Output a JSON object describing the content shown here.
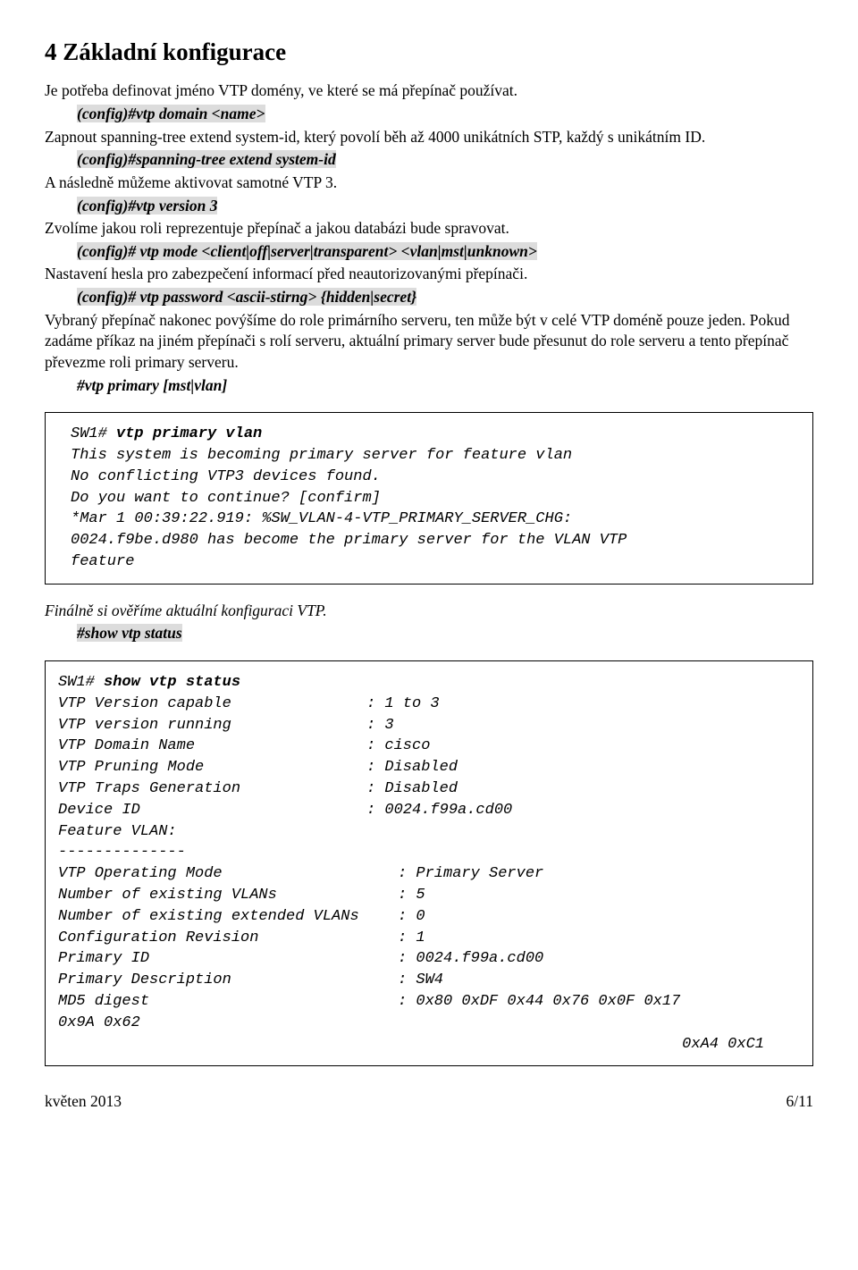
{
  "heading": "4  Základní konfigurace",
  "p_intro": "Je potřeba definovat jméno VTP domény, ve které se má přepínač používat.",
  "cmd1": "(config)#vtp domain <name>",
  "p_after_cmd1": "Zapnout spanning-tree extend system-id, který povolí běh až 4000 unikátních STP, každý s unikátním ID.",
  "cmd2": "(config)#spanning-tree extend system-id",
  "p_after_cmd2": "A následně můžeme aktivovat samotné VTP 3.",
  "cmd3": "(config)#vtp version 3",
  "p_after_cmd3": "Zvolíme jakou roli reprezentuje přepínač a jakou databázi bude spravovat.",
  "cmd4": "(config)# vtp mode <client|off|server|transparent> <vlan|mst|unknown>",
  "p_after_cmd4": "Nastavení hesla pro zabezpečení informací před neautorizovanými přepínači.",
  "cmd5": "(config)# vtp password <ascii-stirng> {hidden|secret}",
  "p_after_cmd5": "Vybraný přepínač nakonec povýšíme do role primárního serveru, ten může být v celé VTP doméně pouze jeden. Pokud zadáme příkaz na jiném přepínači s rolí serveru, aktuální primary server bude přesunut do role serveru a tento přepínač převezme roli primary serveru.",
  "cmd6": "#vtp primary [mst|vlan]",
  "codebox1": {
    "prompt": "SW1# ",
    "cmd": "vtp primary vlan",
    "lines": [
      "This system is becoming primary server for feature vlan",
      "No conflicting VTP3 devices found.",
      "Do you want to continue? [confirm]",
      "*Mar 1 00:39:22.919: %SW_VLAN-4-VTP_PRIMARY_SERVER_CHG:",
      "0024.f9be.d980 has become the primary server for the VLAN VTP",
      "feature"
    ]
  },
  "p_final": "Finálně si ověříme aktuální konfiguraci VTP.",
  "cmd7": "#show vtp status",
  "codebox2": {
    "prompt": "SW1# ",
    "cmd": "show vtp status",
    "rows": [
      {
        "k": "VTP Version capable",
        "v": ": 1 to 3"
      },
      {
        "k": "VTP version running",
        "v": ": 3"
      },
      {
        "k": "VTP Domain Name",
        "v": ": cisco"
      },
      {
        "k": "VTP Pruning Mode",
        "v": ": Disabled"
      },
      {
        "k": "VTP Traps Generation",
        "v": ": Disabled"
      },
      {
        "k": "Device ID",
        "v": ": 0024.f99a.cd00"
      }
    ],
    "plain1": "Feature VLAN:",
    "plain2": "--------------",
    "rows2": [
      {
        "k": "VTP Operating Mode",
        "v": ": Primary Server"
      },
      {
        "k": "Number of existing VLANs",
        "v": ": 5"
      },
      {
        "k": "Number of existing extended VLANs",
        "v": ": 0"
      },
      {
        "k": "Configuration Revision",
        "v": ": 1"
      },
      {
        "k": "Primary ID",
        "v": ": 0024.f99a.cd00"
      },
      {
        "k": "Primary Description",
        "v": ": SW4"
      },
      {
        "k": "MD5 digest",
        "v": ": 0x80 0xDF 0x44 0x76 0x0F 0x17"
      }
    ],
    "tail1": "0x9A 0x62",
    "tail2": "0xA4 0xC1"
  },
  "footer_left": "květen 2013",
  "footer_right": "6/11"
}
